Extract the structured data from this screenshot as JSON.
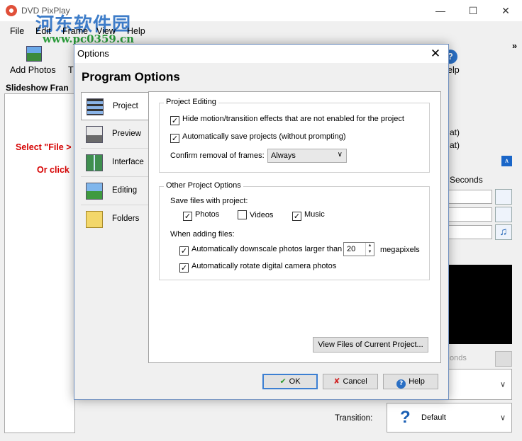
{
  "app": {
    "title": "DVD PixPlay",
    "watermark_cn": "河东软件园",
    "watermark_url": "www.pc0359.cn",
    "menu": [
      "File",
      "Edit",
      "Frame",
      "View",
      "Help"
    ],
    "toolbar": {
      "add_photos": "Add Photos",
      "t_partial": "T",
      "help_partial": "elp",
      "more": "»"
    },
    "panel_title": "Slideshow Fran",
    "hint_line1": "Select \"File >",
    "hint_line2": "Or click",
    "right_partial_1": "at)",
    "right_partial_2": "at)",
    "seconds_label": "Seconds",
    "onds_partial": "onds",
    "transition_label": "Transition:",
    "transition_value": "Default"
  },
  "dialog": {
    "title": "Options",
    "heading": "Program Options",
    "nav": [
      {
        "label": "Project",
        "icon": "film-icon",
        "selected": true
      },
      {
        "label": "Preview",
        "icon": "projector-icon",
        "selected": false
      },
      {
        "label": "Interface",
        "icon": "interface-icon",
        "selected": false
      },
      {
        "label": "Editing",
        "icon": "editing-icon",
        "selected": false
      },
      {
        "label": "Folders",
        "icon": "folders-icon",
        "selected": false
      }
    ],
    "project_editing": {
      "title": "Project Editing",
      "hide_effects": "Hide motion/transition effects that are not enabled for the project",
      "hide_effects_checked": true,
      "auto_save": "Automatically save projects (without prompting)",
      "auto_save_checked": true,
      "confirm_label": "Confirm removal of frames:",
      "confirm_value": "Always"
    },
    "other_options": {
      "title": "Other Project Options",
      "save_with_label": "Save files with project:",
      "photos": "Photos",
      "photos_checked": true,
      "videos": "Videos",
      "videos_checked": false,
      "music": "Music",
      "music_checked": true,
      "when_adding_label": "When adding files:",
      "downscale": "Automatically downscale photos larger than",
      "downscale_checked": true,
      "downscale_value": "20",
      "megapixels": "megapixels",
      "rotate": "Automatically rotate digital camera photos",
      "rotate_checked": true
    },
    "view_files_button": "View Files of Current Project...",
    "ok_button": "OK",
    "cancel_button": "Cancel",
    "help_button": "Help"
  },
  "colors": {
    "accent": "#3c7fd2",
    "hint_red": "#d60000",
    "watermark_blue": "#2a6fc4",
    "watermark_green": "#2a9a3a"
  }
}
